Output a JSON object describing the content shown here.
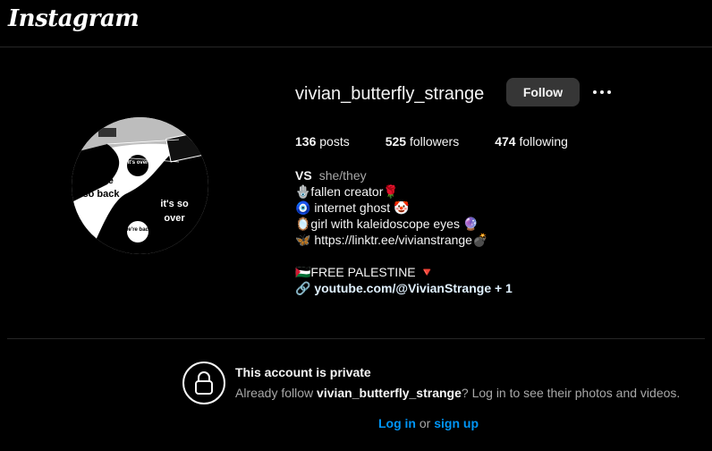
{
  "header": {
    "logo": "Instagram"
  },
  "profile": {
    "username": "vivian_butterfly_strange",
    "follow_label": "Follow",
    "stats": {
      "posts_count": "136",
      "posts_label": "posts",
      "followers_count": "525",
      "followers_label": "followers",
      "following_count": "474",
      "following_label": "following"
    },
    "avatar_text": {
      "left": "we're so back",
      "right": "it's so over",
      "small_top": "it's over",
      "small_bottom": "we're back"
    },
    "bio": {
      "name": "VS",
      "pronouns": "she/they",
      "lines": [
        "🪬fallen creator🌹",
        "🧿 internet ghost 🤡",
        "🪞girl with kaleidoscope eyes 🔮",
        "🦋 https://linktr.ee/vivianstrange💣"
      ],
      "palestine": "🇵🇸FREE PALESTINE 🔻",
      "link_icon": "🔗",
      "link_text": "youtube.com/@VivianStrange + 1"
    }
  },
  "private_notice": {
    "title": "This account is private",
    "msg_before": "Already follow ",
    "msg_username": "vivian_butterfly_strange",
    "msg_after": "? Log in to see their photos and videos.",
    "login_label": "Log in",
    "or_label": "or",
    "signup_label": "sign up"
  },
  "icons": {
    "lock": "lock-icon",
    "more": "more-options-icon",
    "link": "link-icon"
  },
  "colors": {
    "background": "#000000",
    "link_blue": "#0095f6",
    "button_bg": "#363636",
    "secondary_text": "#a8a8a8"
  }
}
